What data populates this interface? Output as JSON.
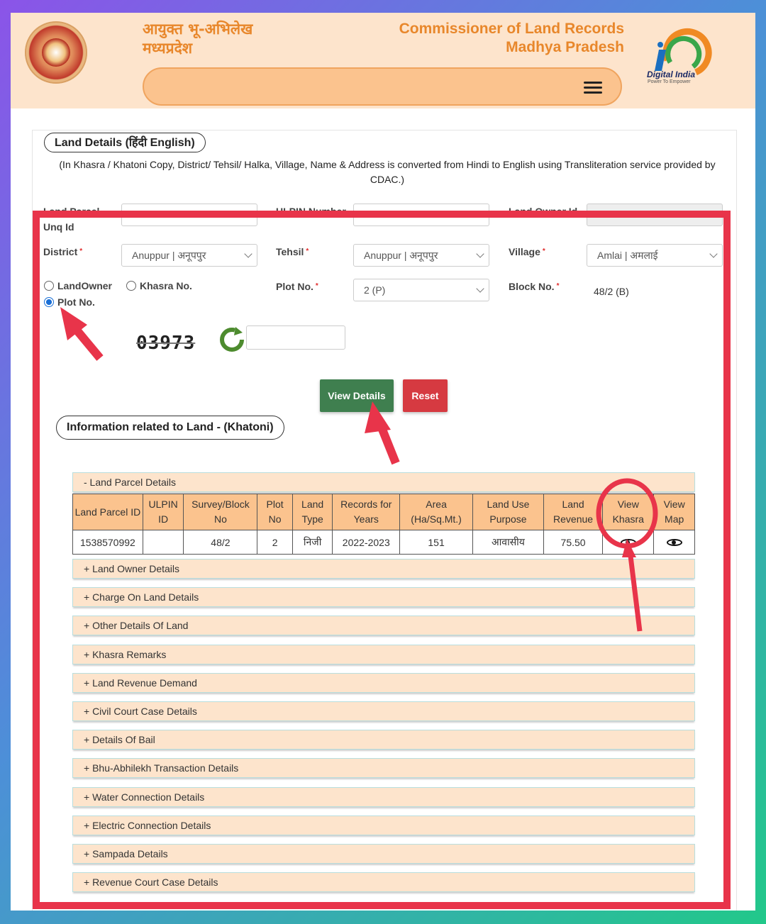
{
  "header": {
    "hindi_line1": "आयुक्त भू-अभिलेख",
    "hindi_line2": "मध्यप्रदेश",
    "english_line1": "Commissioner of Land Records",
    "english_line2": "Madhya Pradesh",
    "digital_india": "Digital India",
    "digital_india_tagline": "Power To Empower",
    "menu_icon": "hamburger-icon",
    "colors": {
      "header_bg": "#fde4cc",
      "title": "#e8872b",
      "nav_pill": "#fbc38e"
    }
  },
  "land_details": {
    "heading": "Land Details  (हिंदी   English)",
    "note": "(In Khasra / Khatoni Copy, District/ Tehsil/ Halka, Village, Name & Address is converted from Hindi to English using Transliteration service provided by CDAC.)"
  },
  "form": {
    "land_parcel_label": "Land Parcel Unq Id",
    "ulpin_label": "ULPIN Number",
    "land_owner_label": "Land Owner Id",
    "district_label": "District",
    "district_value": "Anuppur | अनूपपुर",
    "tehsil_label": "Tehsil",
    "tehsil_value": "Anuppur | अनूपपुर",
    "village_label": "Village",
    "village_value": "Amlai | अमलाई",
    "radio_landowner": "LandOwner",
    "radio_khasra": "Khasra No.",
    "radio_plot": "Plot No.",
    "selected_radio": "Plot No.",
    "plot_label": "Plot No.",
    "plot_value": "2 (P)",
    "block_label": "Block No.",
    "block_value": "48/2 (B)",
    "captcha_text": "03973",
    "captcha_input": "",
    "view_button": "View Details",
    "reset_button": "Reset",
    "colors": {
      "view_button": "#3f7f4f",
      "reset_button": "#d63a41",
      "required": "#e02b2b"
    }
  },
  "khatoni": {
    "heading": "Information related to Land -    (Khatoni)",
    "parcel_section": "- Land Parcel Details",
    "columns": [
      "Land Parcel ID",
      "ULPIN ID",
      "Survey/Block No",
      "Plot No",
      "Land Type",
      "Records for Years",
      "Area (Ha/Sq.Mt.)",
      "Land Use Purpose",
      "Land Revenue",
      "View Khasra",
      "View Map"
    ],
    "row": [
      "1538570992",
      "",
      "48/2",
      "2",
      "निजी",
      "2022-2023",
      "151",
      "आवासीय",
      "75.50"
    ],
    "view_icon": "eye-icon",
    "sections": [
      "+ Land Owner Details",
      "+ Charge On Land Details",
      "+ Other Details Of Land",
      "+ Khasra Remarks",
      "+ Land Revenue Demand",
      "+ Civil Court Case Details",
      "+ Details Of Bail",
      "+ Bhu-Abhilekh Transaction Details",
      "+ Water Connection Details",
      "+ Electric Connection Details",
      "+ Sampada Details",
      "+ Revenue Court Case Details"
    ]
  },
  "annotation_color": "#e8344a"
}
